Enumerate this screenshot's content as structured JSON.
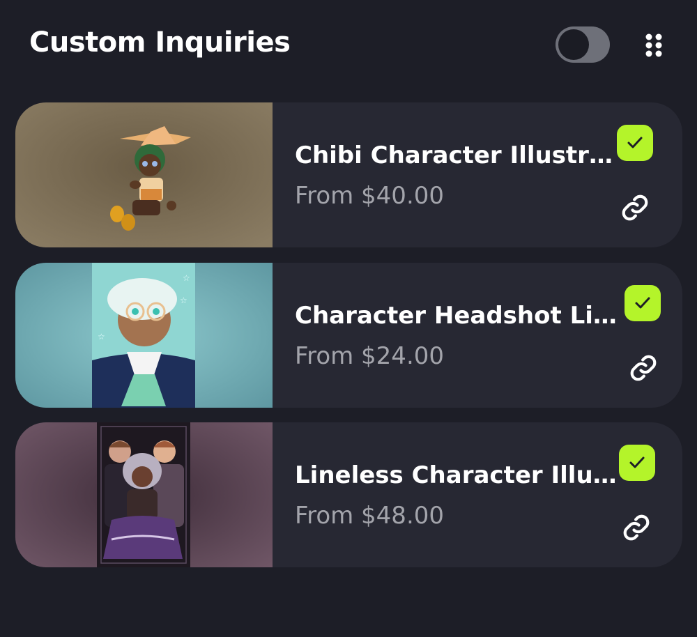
{
  "header": {
    "title": "Custom Inquiries",
    "toggle_on": false,
    "menu_icon": "grid-dots-icon"
  },
  "colors": {
    "background": "#1d1e27",
    "card": "#272833",
    "accent": "#b4f42a",
    "muted_text": "#a3a4ab"
  },
  "items": [
    {
      "title": "Chibi Character Illustrati...",
      "price": "From $40.00",
      "selected": true,
      "link_icon": "link-icon"
    },
    {
      "title": "Character Headshot Linel...",
      "price": "From $24.00",
      "selected": true,
      "link_icon": "link-icon"
    },
    {
      "title": "Lineless Character Illustr...",
      "price": "From $48.00",
      "selected": true,
      "link_icon": "link-icon"
    }
  ]
}
